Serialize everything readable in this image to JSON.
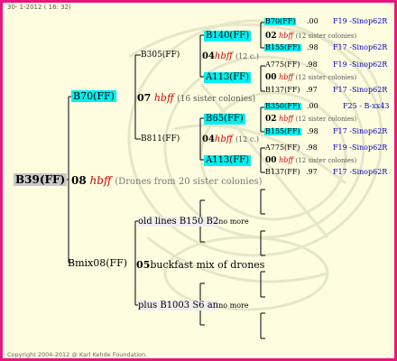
{
  "header": "30-  1-2012 ( 16: 32)",
  "footer": "Copyright 2004-2012 @ Karl Kehde Foundation.",
  "colors": {
    "border": "#e8157e",
    "background": "#fffde0",
    "highlight": "#00f0f0",
    "root_bg": "#c8c8c8",
    "hbff": "#cc0000",
    "link": "#0000c0"
  },
  "root": {
    "id": "B39(FF)",
    "num": "08",
    "hbff": "hbff",
    "note": "(Drones from 20 sister colonies)"
  },
  "g1": {
    "b70": {
      "id": "B70(FF)",
      "num": "07",
      "hbff": "hbff",
      "note": "(16 sister colonies)"
    },
    "bmix": {
      "id": "Bmix08(FF)",
      "num": "05",
      "text": "buckfast mix of drones"
    }
  },
  "g2": {
    "b305": "B305(FF)",
    "b811": "B811(FF)",
    "oldlines": {
      "text": "old lines B150 B2",
      "suffix": "no more"
    },
    "plus": {
      "text": "plus B1003 S6 an",
      "suffix": "no more"
    }
  },
  "g3": [
    {
      "id": "B140(FF)",
      "num": "04",
      "hbff": "hbff",
      "note": "(12 c.)"
    },
    {
      "id": "A113(FF)"
    },
    {
      "id": "B65(FF)",
      "num": "04",
      "hbff": "hbff",
      "note": "(12 c.)"
    },
    {
      "id": "A113(FF)"
    }
  ],
  "g4": [
    {
      "id": "B70(FF)",
      "val": ".00",
      "ref": "F19 -Sinop62R"
    },
    {
      "num": "02",
      "hbff": "hbff",
      "note": "(12 sister colonies)"
    },
    {
      "id": "B155(FF)",
      "val": ".98",
      "ref": "F17 -Sinop62R"
    },
    {
      "id": "A775(FF)",
      "val": ".98",
      "ref": "F19 -Sinop62R"
    },
    {
      "num": "00",
      "hbff": "hbff",
      "note": "(12 sister colonies)"
    },
    {
      "id": "B137(FF)",
      "val": ".97",
      "ref": "F17 -Sinop62R"
    },
    {
      "id": "B350(FF)",
      "val": ".00",
      "ref": "F25 - B-xx43"
    },
    {
      "num": "02",
      "hbff": "hbff",
      "note": "(12 sister colonies)"
    },
    {
      "id": "B155(FF)",
      "val": ".98",
      "ref": "F17 -Sinop62R"
    },
    {
      "id": "A775(FF)",
      "val": ".98",
      "ref": "F19 -Sinop62R"
    },
    {
      "num": "00",
      "hbff": "hbff",
      "note": "(12 sister colonies)"
    },
    {
      "id": "B137(FF)",
      "val": ".97",
      "ref": "F17 -Sinop62R"
    }
  ]
}
